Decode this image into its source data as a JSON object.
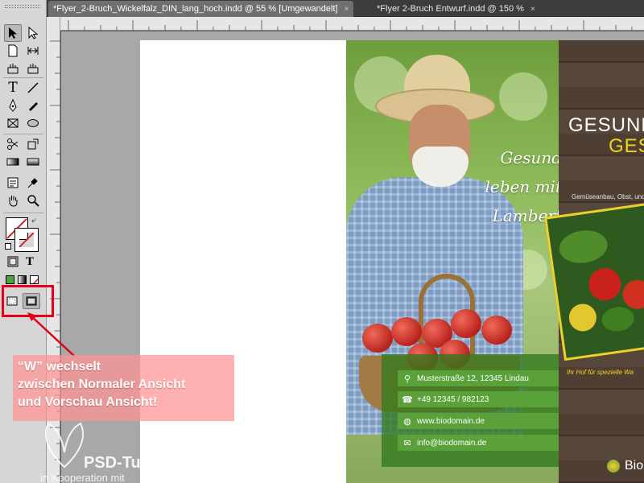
{
  "tabs": [
    {
      "label": "*Flyer_2-Bruch_Wickelfalz_DIN_lang_hoch.indd @ 55 % [Umgewandelt]",
      "close": "×",
      "active": true
    },
    {
      "label": "*Flyer 2-Bruch Entwurf.indd @ 150 %",
      "close": "×",
      "active": false
    }
  ],
  "tools": {
    "text_tool_glyph": "T",
    "format_text_glyph": "T"
  },
  "flyer": {
    "tagline": [
      "Gesund",
      "leben mit",
      "Lambert"
    ],
    "contact": [
      {
        "icon": "location-pin-icon",
        "text": "Musterstraße 12, 12345 Lindau"
      },
      {
        "icon": "phone-icon",
        "text": "+49 12345 / 982123"
      },
      {
        "icon": "globe-icon",
        "text": "www.biodomain.de"
      },
      {
        "icon": "mail-icon",
        "text": "info@biodomain.de"
      }
    ],
    "heading_line1": "GESUND",
    "heading_line2": "GES",
    "subtitle": "Gemüseanbau, Obst, und",
    "subtitle2": "Ihr Hof für spezielle Wa",
    "logo_text": "Bio"
  },
  "annotation": {
    "lines": [
      "“W” wechselt",
      "zwischen Normaler Ansicht",
      "und Vorschau Ansicht!"
    ],
    "highlight_color": "#e3001b"
  },
  "watermark": {
    "brand": "PSD-Tutorials.de",
    "sub": "in Kooperation mit"
  },
  "colors": {
    "accent_green": "#5aa13a",
    "accent_yellow": "#f3d321",
    "wood": "#4f3f33"
  }
}
